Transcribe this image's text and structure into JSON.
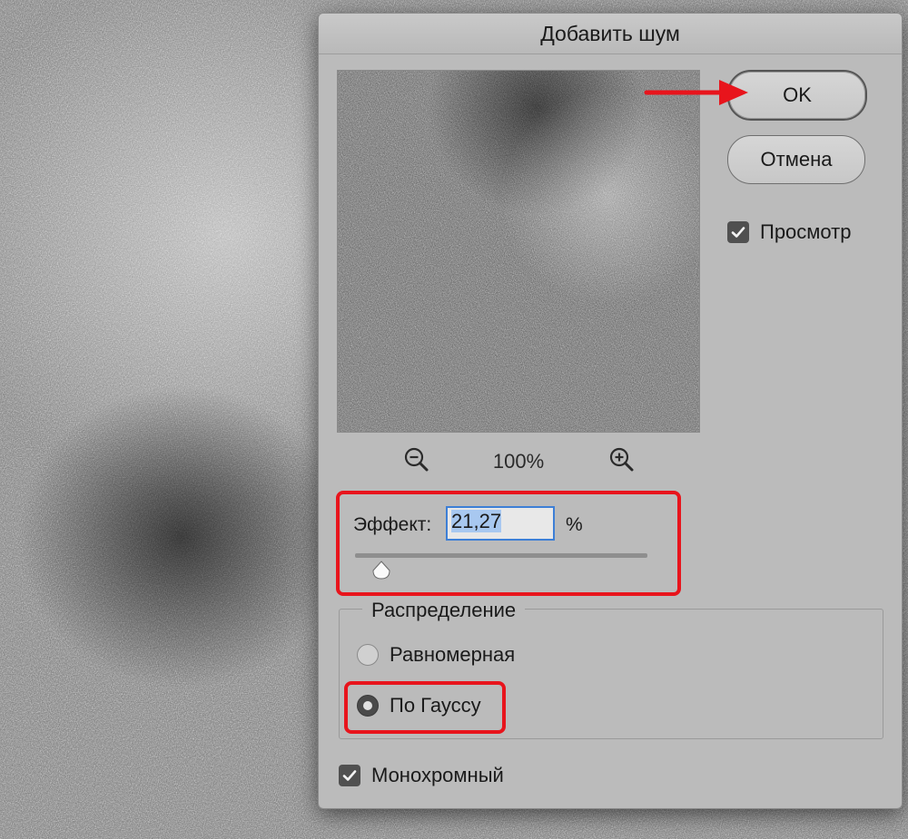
{
  "dialog": {
    "title": "Добавить шум"
  },
  "buttons": {
    "ok_label": "OK",
    "cancel_label": "Отмена"
  },
  "preview": {
    "checkbox_label": "Просмотр",
    "checked": true,
    "zoom_level": "100%"
  },
  "effect": {
    "label": "Эффект:",
    "value": "21,27",
    "unit": "%",
    "slider_fraction": 0.0532
  },
  "distribution": {
    "legend": "Распределение",
    "options": [
      {
        "label": "Равномерная",
        "selected": false
      },
      {
        "label": "По Гауссу",
        "selected": true
      }
    ]
  },
  "monochrome": {
    "label": "Монохромный",
    "checked": true
  },
  "annotations": {
    "highlight_color": "#e8141c"
  },
  "colors": {
    "dialog_bg": "#bbbbbb",
    "input_focus": "#3d7fd6"
  }
}
